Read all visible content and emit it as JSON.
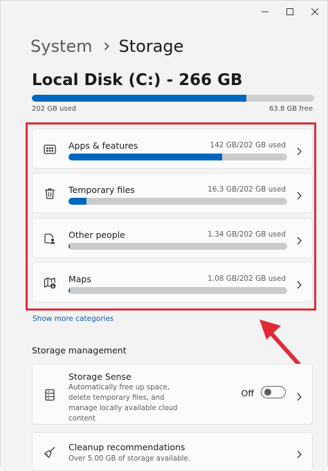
{
  "breadcrumb": {
    "parent": "System",
    "current": "Storage"
  },
  "disk": {
    "title": "Local Disk (C:) - 266 GB",
    "used_label": "202 GB used",
    "free_label": "63.8 GB free",
    "used_fraction": 0.759
  },
  "categories": [
    {
      "label": "Apps & features",
      "size": "142 GB/202 GB used",
      "fraction": 0.703,
      "icon": "apps-icon"
    },
    {
      "label": "Temporary files",
      "size": "16.3 GB/202 GB used",
      "fraction": 0.081,
      "icon": "trash-icon"
    },
    {
      "label": "Other people",
      "size": "1.34 GB/202 GB used",
      "fraction": 0.007,
      "icon": "other-people-icon"
    },
    {
      "label": "Maps",
      "size": "1.08 GB/202 GB used",
      "fraction": 0.005,
      "icon": "maps-icon"
    }
  ],
  "show_more": "Show more categories",
  "storage_management": {
    "title": "Storage management",
    "storage_sense": {
      "title": "Storage Sense",
      "description": "Automatically free up space, delete temporary files, and manage locally available cloud content",
      "toggle_label": "Off",
      "toggle_on": false
    },
    "cleanup": {
      "title": "Cleanup recommendations",
      "description": "Over 5.00 GB of storage available."
    }
  },
  "colors": {
    "accent": "#0067c0",
    "highlight": "#e02b37",
    "link": "#0a5fb0"
  }
}
